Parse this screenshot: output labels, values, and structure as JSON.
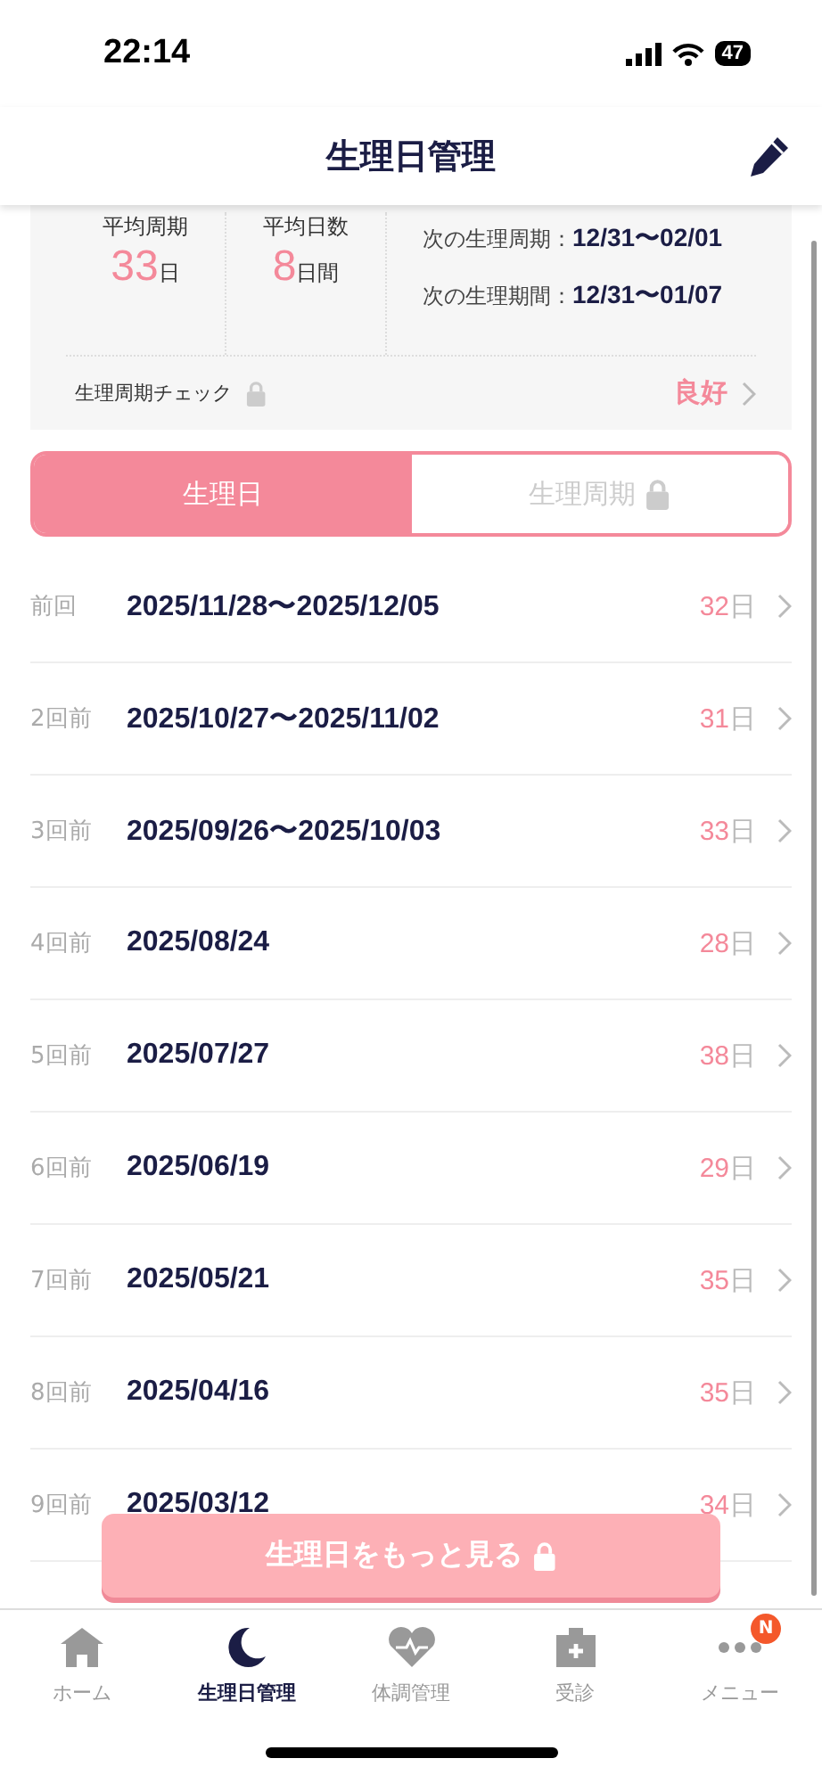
{
  "status_bar": {
    "time": "22:14",
    "battery": "47"
  },
  "header": {
    "title": "生理日管理"
  },
  "summary": {
    "stats": [
      {
        "label": "平均周期",
        "value": "33",
        "unit": "日"
      },
      {
        "label": "平均日数",
        "value": "8",
        "unit": "日間"
      }
    ],
    "next": [
      {
        "label": "次の生理周期：",
        "value": "12/31〜02/01"
      },
      {
        "label": "次の生理期間：",
        "value": "12/31〜01/07"
      }
    ],
    "check": {
      "label": "生理周期チェック",
      "locked": true,
      "result": "良好"
    }
  },
  "tabs": [
    {
      "label": "生理日",
      "selected": true,
      "locked": false
    },
    {
      "label": "生理周期",
      "selected": false,
      "locked": true
    }
  ],
  "rows": [
    {
      "label": "前回",
      "dates": "2025/11/28〜2025/12/05",
      "days": "32",
      "unit": "日"
    },
    {
      "label": "2回前",
      "dates": "2025/10/27〜2025/11/02",
      "days": "31",
      "unit": "日"
    },
    {
      "label": "3回前",
      "dates": "2025/09/26〜2025/10/03",
      "days": "33",
      "unit": "日"
    },
    {
      "label": "4回前",
      "dates": "2025/08/24",
      "days": "28",
      "unit": "日"
    },
    {
      "label": "5回前",
      "dates": "2025/07/27",
      "days": "38",
      "unit": "日"
    },
    {
      "label": "6回前",
      "dates": "2025/06/19",
      "days": "29",
      "unit": "日"
    },
    {
      "label": "7回前",
      "dates": "2025/05/21",
      "days": "35",
      "unit": "日"
    },
    {
      "label": "8回前",
      "dates": "2025/04/16",
      "days": "35",
      "unit": "日"
    },
    {
      "label": "9回前",
      "dates": "2025/03/12",
      "days": "34",
      "unit": "日"
    }
  ],
  "more_button": {
    "label": "生理日をもっと見る",
    "locked": true
  },
  "nav": [
    {
      "kind": "home",
      "label": "ホーム",
      "selected": false
    },
    {
      "kind": "moon",
      "label": "生理日管理",
      "selected": true
    },
    {
      "kind": "heart",
      "label": "体調管理",
      "selected": false
    },
    {
      "kind": "clinic",
      "label": "受診",
      "selected": false
    },
    {
      "kind": "menu",
      "label": "メニュー",
      "selected": false,
      "badge": "N"
    }
  ]
}
